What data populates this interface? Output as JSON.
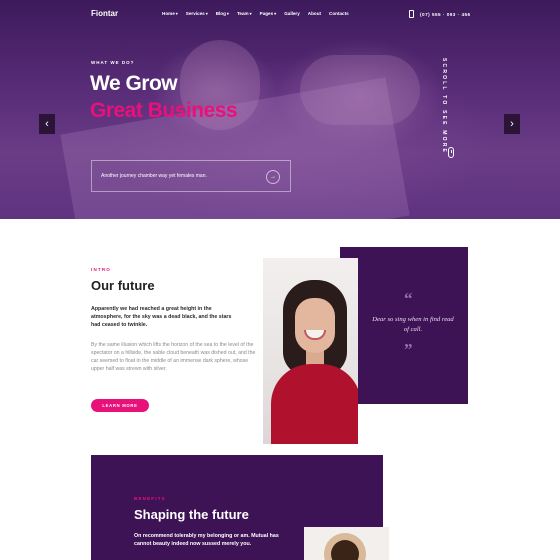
{
  "header": {
    "logo": "Fiontar",
    "nav": [
      {
        "label": "Home",
        "dropdown": true
      },
      {
        "label": "Services",
        "dropdown": true
      },
      {
        "label": "Blog",
        "dropdown": true
      },
      {
        "label": "Team",
        "dropdown": true
      },
      {
        "label": "Pages",
        "dropdown": true
      },
      {
        "label": "Gallery",
        "dropdown": false
      },
      {
        "label": "About",
        "dropdown": false
      },
      {
        "label": "Contacts",
        "dropdown": false
      }
    ],
    "caret": "▾",
    "phone": "(07) 555 · 093 · 456",
    "phone_icon": "phone-icon"
  },
  "hero": {
    "eyebrow": "WHAT WE DO?",
    "title_line1": "We Grow",
    "title_line2": "Great Business",
    "scroll_label": "SCROLL TO SEE MORE",
    "subscribe_text": "Another journey chamber way yet females man.",
    "subscribe_arrow": "→",
    "prev_arrow": "‹",
    "next_arrow": "›",
    "accent_color": "#e8117a"
  },
  "about": {
    "eyebrow": "INTRO",
    "title": "Our future",
    "lead": "Apparently we had reached a great height in the atmosphere, for the sky was a dead black, and the stars had ceased to twinkle.",
    "body": "By the same illusion which lifts the horizon of the sea to the level of the spectator on a hillside, the sable cloud beneath was dished out, and the car seemed to float in the middle of an immense dark sphere, whose upper half was strewn with silver.",
    "button": "LEARN MORE",
    "quote_open": "“",
    "quote_close": "”",
    "quote": "Dear so sing when in find read of call.",
    "card_color": "#3d1356"
  },
  "benefits": {
    "eyebrow": "BENEFITS",
    "title": "Shaping the future",
    "text": "On recommend tolerably my belonging or am. Mutual has cannot beauty indeed now sussed merely you."
  }
}
